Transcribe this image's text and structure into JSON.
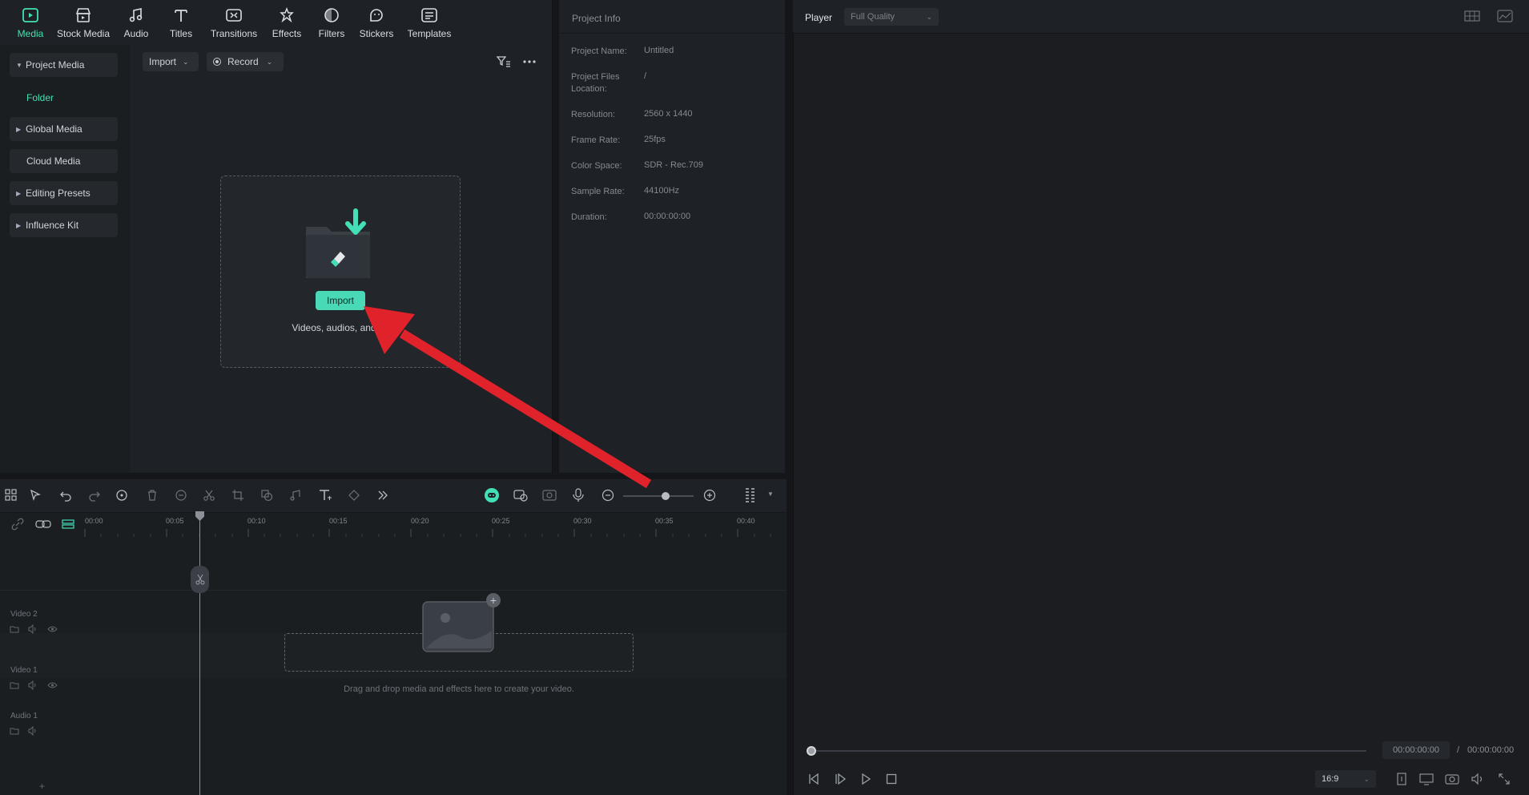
{
  "toolbar": {
    "items": [
      {
        "label": "Media",
        "icon": "media-icon"
      },
      {
        "label": "Stock Media",
        "icon": "stock-media-icon"
      },
      {
        "label": "Audio",
        "icon": "music-note-icon"
      },
      {
        "label": "Titles",
        "icon": "title-t-icon"
      },
      {
        "label": "Transitions",
        "icon": "transitions-icon"
      },
      {
        "label": "Effects",
        "icon": "effects-icon"
      },
      {
        "label": "Filters",
        "icon": "filters-icon"
      },
      {
        "label": "Stickers",
        "icon": "stickers-icon"
      },
      {
        "label": "Templates",
        "icon": "templates-icon"
      }
    ],
    "active": "Media"
  },
  "sidebar": {
    "items": [
      {
        "label": "Project Media",
        "expanded": true
      },
      {
        "label": "Folder"
      },
      {
        "label": "Global Media"
      },
      {
        "label": "Cloud Media"
      },
      {
        "label": "Editing Presets"
      },
      {
        "label": "Influence Kit"
      }
    ]
  },
  "media": {
    "import_label": "Import",
    "record_label": "Record",
    "drop_button": "Import",
    "drop_hint": "Videos, audios, and im"
  },
  "project_info": {
    "title": "Project Info",
    "rows": [
      {
        "key": "Project Name:",
        "value": "Untitled"
      },
      {
        "key": "Project Files Location:",
        "value": "/"
      },
      {
        "key": "Resolution:",
        "value": "2560 x 1440"
      },
      {
        "key": "Frame Rate:",
        "value": "25fps"
      },
      {
        "key": "Color Space:",
        "value": "SDR - Rec.709"
      },
      {
        "key": "Sample Rate:",
        "value": "44100Hz"
      },
      {
        "key": "Duration:",
        "value": "00:00:00:00"
      }
    ]
  },
  "player": {
    "label": "Player",
    "quality": "Full Quality",
    "current_time": "00:00:00:00",
    "separator": "/",
    "total_time": "00:00:00:00",
    "aspect_ratio": "16:9"
  },
  "timeline": {
    "ruler": [
      "00:00",
      "00:05",
      "00:10",
      "00:15",
      "00:20",
      "00:25",
      "00:30",
      "00:35",
      "00:40"
    ],
    "tracks": [
      "Video 2",
      "Video 1",
      "Audio 1"
    ],
    "drop_hint": "Drag and drop media and effects here to create your video.",
    "add_track": "+"
  },
  "colors": {
    "accent": "#43e0b8",
    "annotation_arrow": "#e0222a"
  }
}
